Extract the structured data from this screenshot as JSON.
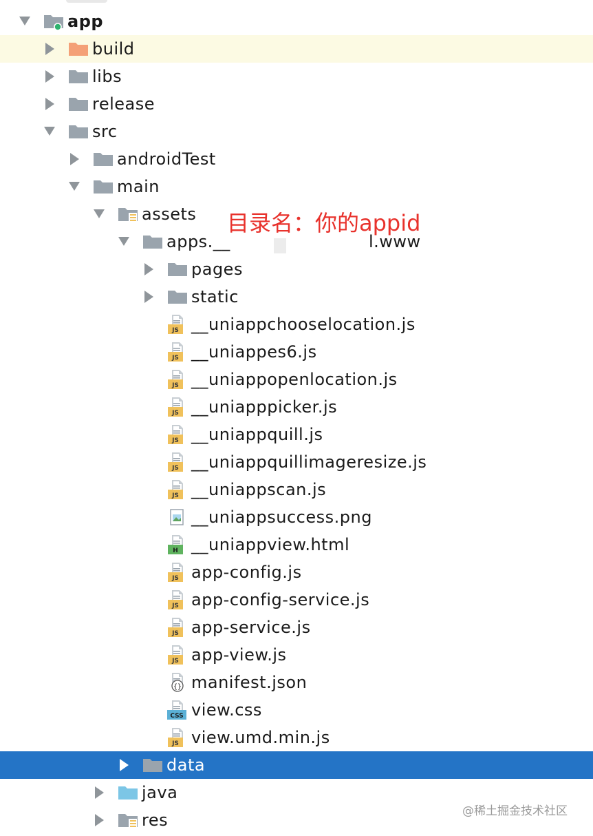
{
  "tree": [
    {
      "label": "app",
      "kind": "module",
      "expanded": true,
      "bold": true
    },
    {
      "label": "build",
      "kind": "folder-orange",
      "expanded": false,
      "highlight": true
    },
    {
      "label": "libs",
      "kind": "folder",
      "expanded": false
    },
    {
      "label": "release",
      "kind": "folder",
      "expanded": false
    },
    {
      "label": "src",
      "kind": "folder",
      "expanded": true
    },
    {
      "label": "androidTest",
      "kind": "folder",
      "expanded": false
    },
    {
      "label": "main",
      "kind": "folder",
      "expanded": true
    },
    {
      "label": "assets",
      "kind": "folder-resource",
      "expanded": true
    },
    {
      "label": "apps.__",
      "kind": "folder",
      "expanded": true
    },
    {
      "label": "pages",
      "kind": "folder",
      "expanded": false
    },
    {
      "label": "static",
      "kind": "folder",
      "expanded": false
    },
    {
      "label": "__uniappchooselocation.js",
      "kind": "js"
    },
    {
      "label": "__uniappes6.js",
      "kind": "js"
    },
    {
      "label": "__uniappopenlocation.js",
      "kind": "js"
    },
    {
      "label": "__uniapppicker.js",
      "kind": "js"
    },
    {
      "label": "__uniappquill.js",
      "kind": "js"
    },
    {
      "label": "__uniappquillimageresize.js",
      "kind": "js"
    },
    {
      "label": "__uniappscan.js",
      "kind": "js"
    },
    {
      "label": "__uniappsuccess.png",
      "kind": "image"
    },
    {
      "label": "__uniappview.html",
      "kind": "html"
    },
    {
      "label": "app-config.js",
      "kind": "js"
    },
    {
      "label": "app-config-service.js",
      "kind": "js"
    },
    {
      "label": "app-service.js",
      "kind": "js"
    },
    {
      "label": "app-view.js",
      "kind": "js"
    },
    {
      "label": "manifest.json",
      "kind": "json"
    },
    {
      "label": "view.css",
      "kind": "css"
    },
    {
      "label": "view.umd.min.js",
      "kind": "js"
    },
    {
      "label": "data",
      "kind": "folder",
      "expanded": false,
      "selected": true
    },
    {
      "label": "java",
      "kind": "folder-blue",
      "expanded": false
    },
    {
      "label": "res",
      "kind": "folder-resource",
      "expanded": false
    }
  ],
  "apps_suffix": "l.www",
  "annotation": "目录名：你的appid",
  "watermark": "@稀土掘金技术社区",
  "colors": {
    "selection": "#2474c6",
    "highlight": "#fcfae3",
    "annotation": "#e8322c",
    "folder": "#9aa4ad",
    "folder_orange": "#f4a077",
    "folder_blue": "#7cc6e6",
    "js_badge": "#f0c15b",
    "html_badge": "#5fb35f",
    "css_badge": "#5bb0d6"
  }
}
